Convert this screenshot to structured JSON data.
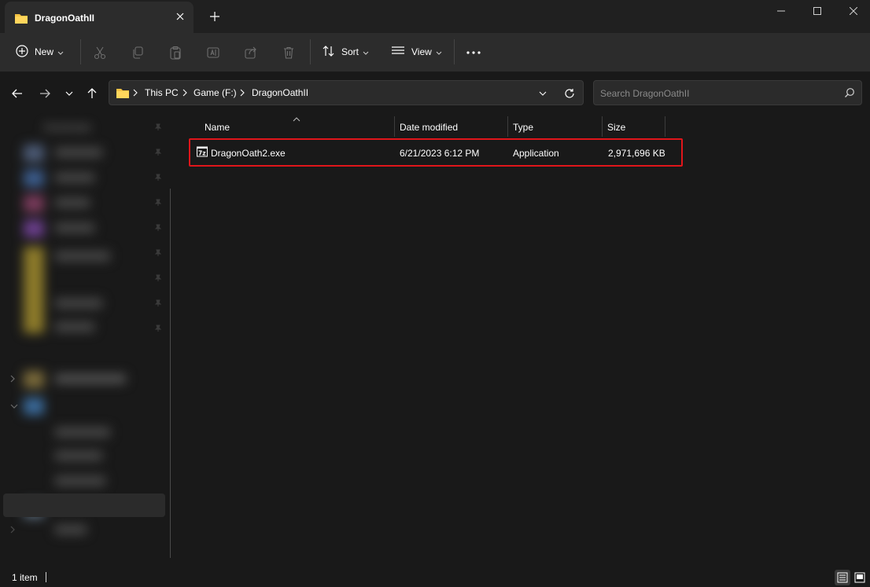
{
  "window": {
    "tab_title": "DragonOathII",
    "new_tab_symbol": "+"
  },
  "toolbar": {
    "new_label": "New",
    "sort_label": "Sort",
    "view_label": "View",
    "more_label": "•••"
  },
  "address": {
    "crumbs": [
      "This PC",
      "Game (F:)",
      "DragonOathII"
    ]
  },
  "search": {
    "placeholder": "Search DragonOathII"
  },
  "file_list": {
    "columns": [
      "Name",
      "Date modified",
      "Type",
      "Size"
    ],
    "rows": [
      {
        "name": "DragonOath2.exe",
        "date_modified": "6/21/2023 6:12 PM",
        "type": "Application",
        "size": "2,971,696 KB",
        "icon": "7z-app-icon"
      }
    ]
  },
  "nav_pane": {
    "first_item": "Downloads"
  },
  "status": {
    "item_count": "1 item"
  },
  "colors": {
    "highlight_border": "#e0151a",
    "folder_yellow": "#f3c244",
    "background": "#191919",
    "toolbar": "#2c2c2c"
  }
}
